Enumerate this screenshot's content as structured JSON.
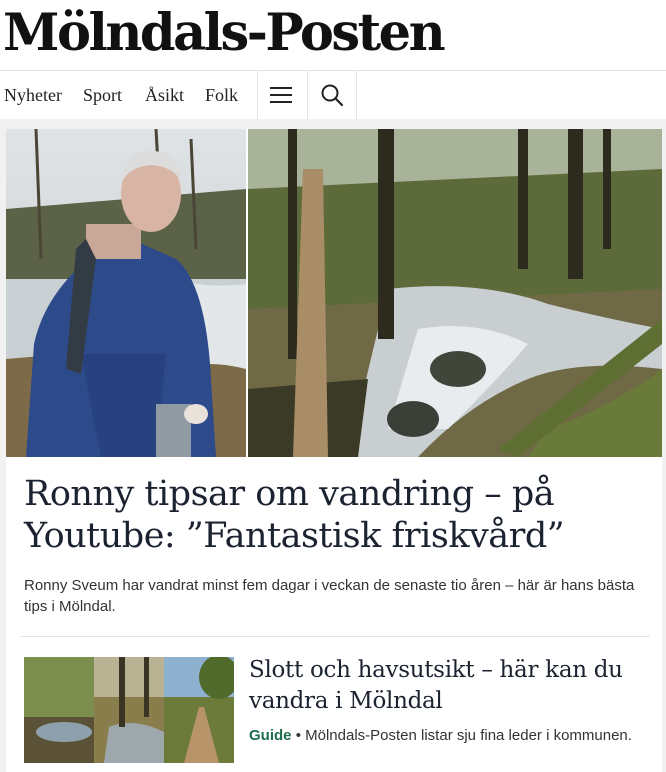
{
  "masthead": {
    "brand": "Mölndals-Posten"
  },
  "nav": {
    "items": [
      {
        "label": "Nyheter"
      },
      {
        "label": "Sport"
      },
      {
        "label": "Åsikt"
      },
      {
        "label": "Folk"
      }
    ],
    "menu_icon": "hamburger-menu-icon",
    "search_icon": "search-icon"
  },
  "main_article": {
    "headline": "Ronny tipsar om vandring – på Youtube: ”Fantastisk friskvård”",
    "lede": "Ronny Sveum har vandrat minst fem dagar i veckan de senaste tio åren – här är hans bästa tips i Mölndal."
  },
  "second_article": {
    "headline": "Slott och havsutsikt – här kan du vandra i Mölndal",
    "tag": "Guide",
    "bullet": "•",
    "summary": "Mölndals-Posten listar sju fina leder i kommunen."
  },
  "colors": {
    "tag": "#1f6e4e",
    "headline": "#1b2230",
    "feed_bg": "#f1f1f1"
  }
}
